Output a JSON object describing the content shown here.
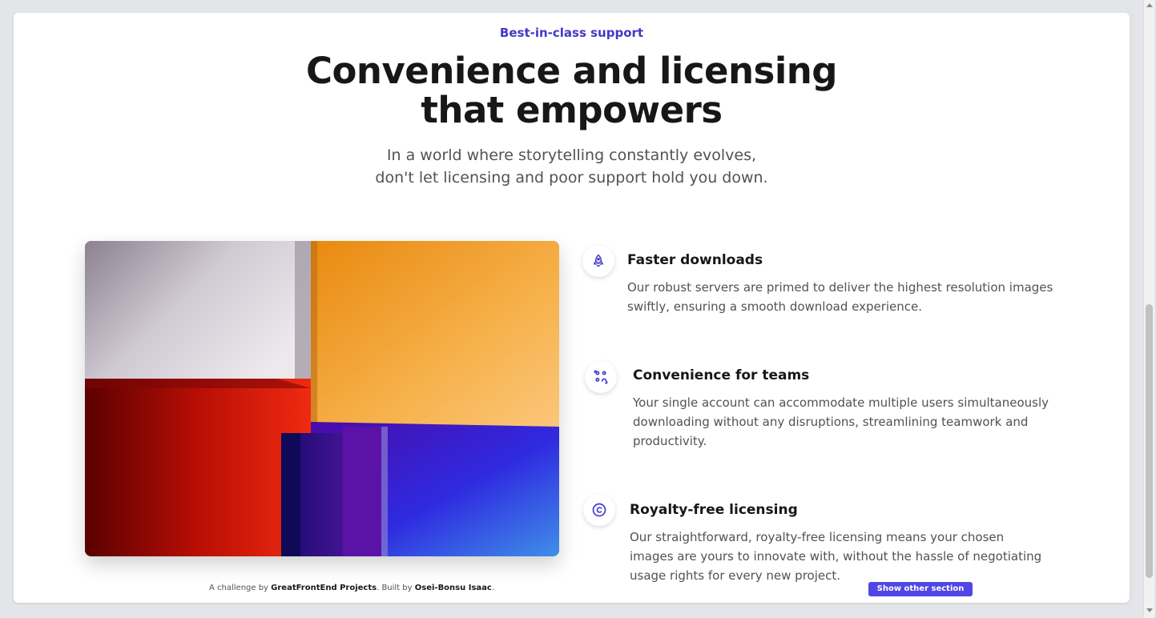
{
  "header": {
    "tag": "Best-in-class support",
    "title_line1": "Convenience and licensing",
    "title_line2": "that empowers",
    "subtitle_line1": "In a world where storytelling constantly evolves,",
    "subtitle_line2": "don't let licensing and poor support hold you down."
  },
  "features": [
    {
      "icon": "rocket-icon",
      "title": "Faster downloads",
      "description": "Our robust servers are primed to deliver the highest resolution images swiftly, ensuring a smooth download experience."
    },
    {
      "icon": "team-icon",
      "title": "Convenience for teams",
      "description": "Your single account can accommodate multiple users simultaneously downloading without any disruptions, streamlining teamwork and productivity."
    },
    {
      "icon": "copyright-icon",
      "title": "Royalty-free licensing",
      "description": "Our straightforward, royalty-free licensing means your chosen images are yours to innovate with, without the hassle of negotiating usage rights for every new project."
    }
  ],
  "footer": {
    "prefix": "A challenge by ",
    "brand": "GreatFrontEnd Projects",
    "middle": ". Built by ",
    "author": "Osei-Bonsu Isaac",
    "suffix": "."
  },
  "show_button": "Show other section",
  "colors": {
    "accent": "#4338ca",
    "button": "#4f46e5"
  }
}
